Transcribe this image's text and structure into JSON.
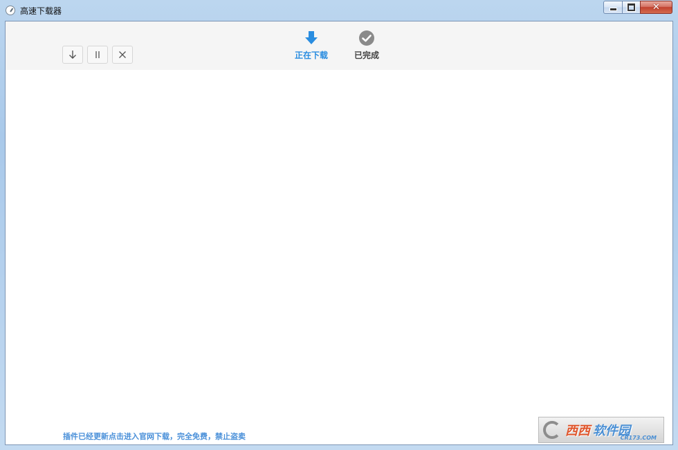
{
  "window": {
    "title": "高速下载器",
    "icons": {
      "app": "speedometer-icon",
      "minimize": "minimize-icon",
      "maximize": "maximize-icon",
      "close": "close-icon"
    }
  },
  "toolbar": {
    "buttons": [
      {
        "icon": "arrow-down-icon"
      },
      {
        "icon": "pause-icon"
      },
      {
        "icon": "close-icon"
      }
    ]
  },
  "tabs": [
    {
      "label": "正在下载",
      "icon": "download-arrow-icon",
      "active": true,
      "color": "#2a8de0"
    },
    {
      "label": "已完成",
      "icon": "check-circle-icon",
      "active": false,
      "color": "#444444"
    }
  ],
  "footer": {
    "notice": "插件已经更新点击进入官网下载，完全免费，禁止盗卖"
  },
  "watermark": {
    "brand": "西西",
    "brand2": "软件园",
    "site": "CR173.COM"
  },
  "colors": {
    "accent": "#2a8de0",
    "toolbar_bg": "#f5f5f5",
    "frame": "#a9c9ea"
  }
}
